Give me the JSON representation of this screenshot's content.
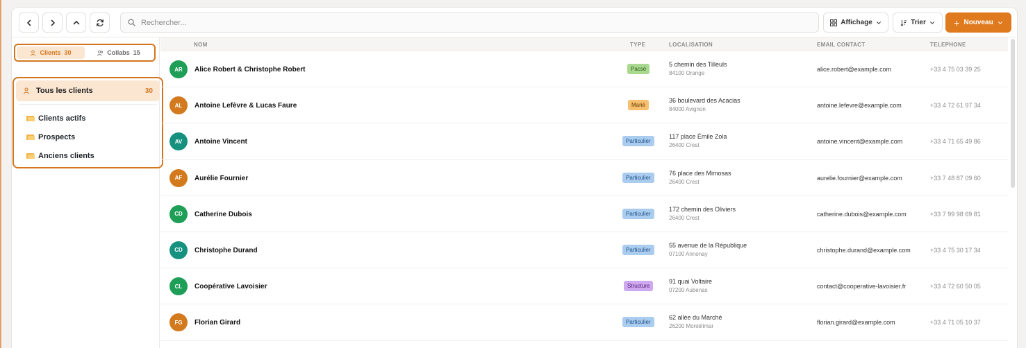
{
  "toolbar": {
    "search_placeholder": "Rechercher...",
    "display_label": "Affichage",
    "sort_label": "Trier",
    "new_label": "Nouveau",
    "accent": "#e07a1f"
  },
  "sidebar": {
    "tabs": [
      {
        "label": "Clients",
        "count": "30",
        "active": true
      },
      {
        "label": "Collabs",
        "count": "15",
        "active": false
      }
    ],
    "all": {
      "label": "Tous les clients",
      "count": "30"
    },
    "folders": [
      {
        "label": "Clients actifs"
      },
      {
        "label": "Prospects"
      },
      {
        "label": "Anciens clients"
      }
    ]
  },
  "table": {
    "columns": {
      "name": "NOM",
      "type": "TYPE",
      "location": "LOCALISATION",
      "email": "EMAIL CONTACT",
      "phone": "TELEPHONE"
    },
    "rows": [
      {
        "initials": "AR",
        "avatar_color": "#1e9e57",
        "name": "Alice Robert & Christophe Robert",
        "type": "Pacsé",
        "type_bg": "#a9d98f",
        "type_fg": "#2f5a1b",
        "addr1": "5 chemin des Tilleuls",
        "addr2": "84100 Orange",
        "email": "alice.robert@example.com",
        "phone": "+33 4 75 03 39 25"
      },
      {
        "initials": "AL",
        "avatar_color": "#d27a1d",
        "name": "Antoine Lefèvre & Lucas Faure",
        "type": "Marié",
        "type_bg": "#f6c06e",
        "type_fg": "#6a3c08",
        "addr1": "36 boulevard des Acacias",
        "addr2": "84000 Avignon",
        "email": "antoine.lefevre@example.com",
        "phone": "+33 4 72 61 97 34"
      },
      {
        "initials": "AV",
        "avatar_color": "#169180",
        "name": "Antoine Vincent",
        "type": "Particulier",
        "type_bg": "#a9ccef",
        "type_fg": "#1f4f85",
        "addr1": "117 place Émile Zola",
        "addr2": "26400 Crest",
        "email": "antoine.vincent@example.com",
        "phone": "+33 4 71 65 49 86"
      },
      {
        "initials": "AF",
        "avatar_color": "#d27a1d",
        "name": "Aurélie Fournier",
        "type": "Particulier",
        "type_bg": "#a9ccef",
        "type_fg": "#1f4f85",
        "addr1": "76 place des Mimosas",
        "addr2": "26400 Crest",
        "email": "aurelie.fournier@example.com",
        "phone": "+33 7 48 87 09 60"
      },
      {
        "initials": "CD",
        "avatar_color": "#1e9e57",
        "name": "Catherine Dubois",
        "type": "Particulier",
        "type_bg": "#a9ccef",
        "type_fg": "#1f4f85",
        "addr1": "172 chemin des Oliviers",
        "addr2": "26400 Crest",
        "email": "catherine.dubois@example.com",
        "phone": "+33 7 99 98 69 81"
      },
      {
        "initials": "CD",
        "avatar_color": "#169180",
        "name": "Christophe Durand",
        "type": "Particulier",
        "type_bg": "#a9ccef",
        "type_fg": "#1f4f85",
        "addr1": "55 avenue de la République",
        "addr2": "07100 Annonay",
        "email": "christophe.durand@example.com",
        "phone": "+33 4 75 30 17 34"
      },
      {
        "initials": "CL",
        "avatar_color": "#1e9e57",
        "name": "Coopérative Lavoisier",
        "type": "Structure",
        "type_bg": "#cfa9ef",
        "type_fg": "#55207f",
        "addr1": "91 quai Voltaire",
        "addr2": "07200 Aubenas",
        "email": "contact@cooperative-lavoisier.fr",
        "phone": "+33 4 72 60 50 05"
      },
      {
        "initials": "FG",
        "avatar_color": "#d27a1d",
        "name": "Florian Girard",
        "type": "Particulier",
        "type_bg": "#a9ccef",
        "type_fg": "#1f4f85",
        "addr1": "62 allée du Marché",
        "addr2": "26200 Montélimar",
        "email": "florian.girard@example.com",
        "phone": "+33 4 71 05 10 37"
      }
    ]
  }
}
